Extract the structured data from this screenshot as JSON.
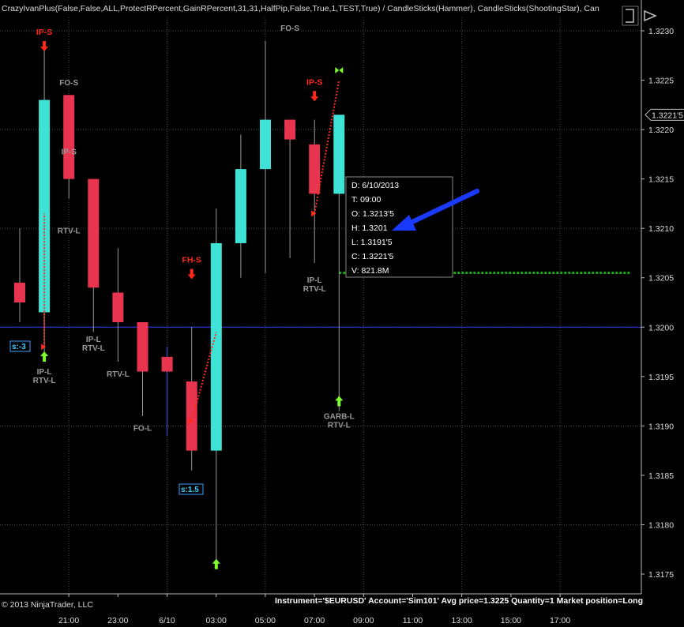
{
  "indicator_title": "CrazyIvanPlus(False,False,ALL,ProtectRPercent,GainRPercent,31,31,HalfPip,False,True,1,TEST,True) / CandleSticks(Hammer), CandleSticks(ShootingStar), Can",
  "colors": {
    "bg": "#000000",
    "up": "#3ee3d6",
    "down": "#e8344e",
    "grid": "#4a4a4a",
    "axis_text": "#dcdcdc",
    "label_gray": "#9a9a9a",
    "signal_red": "#ff2a1a",
    "signal_green": "#7cff2a",
    "blue_line": "#2a3cff",
    "green_dotted": "#1aa81a",
    "arrow_blue": "#1a3aff",
    "tooltip_border": "#8a8a8a"
  },
  "copyright": "© 2013 NinjaTrader, LLC",
  "position_info": "Instrument='$EURUSD' Account='Sim101' Avg price=1.3225 Quantity=1 Market position=Long",
  "tooltip": {
    "lines": [
      "D: 6/10/2013",
      "T: 09:00",
      "O: 1.3213'5",
      "H: 1.3201",
      "L: 1.3191'5",
      "C: 1.3221'5",
      "V: 821.8M"
    ]
  },
  "price_tag": "1.3221'5",
  "stats": [
    "s:-3",
    "s:1.5"
  ],
  "chart_data": {
    "type": "candlestick",
    "title": "",
    "y_ticks": [
      "1.3230",
      "1.3225",
      "1.3220",
      "1.3215",
      "1.3210",
      "1.3205",
      "1.3200",
      "1.3195",
      "1.3190",
      "1.3185",
      "1.3180",
      "1.3175"
    ],
    "ylim": [
      1.3172,
      1.3232
    ],
    "x_tick_labels": [
      "21:00",
      "23:00",
      "6/10",
      "03:00",
      "05:00",
      "07:00",
      "09:00",
      "11:00",
      "13:00",
      "15:00",
      "17:00"
    ],
    "x_tick_bars": [
      1,
      3,
      5,
      7,
      9,
      11,
      13,
      15,
      17,
      19,
      21
    ],
    "candles": [
      {
        "bar": 0,
        "open": 1.32045,
        "high": 1.321,
        "low": 1.32005,
        "close": 1.32025
      },
      {
        "bar": 1,
        "open": 1.32015,
        "high": 1.32285,
        "low": 1.3197,
        "close": 1.3223
      },
      {
        "bar": 2,
        "open": 1.32235,
        "high": 1.32235,
        "low": 1.3213,
        "close": 1.3215
      },
      {
        "bar": 3,
        "open": 1.3215,
        "high": 1.3215,
        "low": 1.31995,
        "close": 1.3204
      },
      {
        "bar": 4,
        "open": 1.32035,
        "high": 1.3208,
        "low": 1.31965,
        "close": 1.32005
      },
      {
        "bar": 5,
        "open": 1.32005,
        "high": 1.32005,
        "low": 1.3191,
        "close": 1.31955
      },
      {
        "bar": 6,
        "open": 1.3197,
        "high": 1.3198,
        "low": 1.3189,
        "close": 1.31955
      },
      {
        "bar": 7,
        "open": 1.31945,
        "high": 1.32,
        "low": 1.31855,
        "close": 1.31875
      },
      {
        "bar": 8,
        "open": 1.31875,
        "high": 1.3212,
        "low": 1.3176,
        "close": 1.32085
      },
      {
        "bar": 9,
        "open": 1.32085,
        "high": 1.32195,
        "low": 1.3205,
        "close": 1.3216
      },
      {
        "bar": 10,
        "open": 1.3216,
        "high": 1.3229,
        "low": 1.32055,
        "close": 1.3221
      },
      {
        "bar": 11,
        "open": 1.3221,
        "high": 1.3221,
        "low": 1.3207,
        "close": 1.3219
      },
      {
        "bar": 12,
        "open": 1.32185,
        "high": 1.3221,
        "low": 1.32065,
        "close": 1.32135
      },
      {
        "bar": 13,
        "open": 1.32135,
        "high": 1.32215,
        "low": 1.31915,
        "close": 1.32215
      }
    ],
    "horizontal_lines": [
      {
        "value": 1.32,
        "style": "solid",
        "color_key": "blue_line"
      },
      {
        "value": 1.32055,
        "style": "dotted",
        "color_key": "green_dotted",
        "from_bar": 13
      }
    ],
    "signals": [
      {
        "bar": 1,
        "type": "down-arrow",
        "color_key": "signal_red",
        "text": "IP-S",
        "at": "top"
      },
      {
        "bar": 1,
        "type": "up-arrow",
        "color_key": "signal_green",
        "text": "IP-L\nRTV-L",
        "at": 1.31965
      },
      {
        "bar": 2,
        "type": "label",
        "text": "FO-S",
        "at": 1.32245
      },
      {
        "bar": 2,
        "type": "label",
        "text": "IP-S",
        "at": 1.32175
      },
      {
        "bar": 2,
        "type": "label",
        "text": "RTV-L",
        "at": 1.32095
      },
      {
        "bar": 3,
        "type": "label",
        "text": "IP-L\nRTV-L",
        "at": 1.31985
      },
      {
        "bar": 4,
        "type": "label",
        "text": "RTV-L",
        "at": 1.3195
      },
      {
        "bar": 5,
        "type": "label",
        "text": "FO-L",
        "at": 1.31895
      },
      {
        "bar": 7,
        "type": "down-arrow",
        "color_key": "signal_red",
        "text": "FH-S",
        "at": 1.32055
      },
      {
        "bar": 8,
        "type": "up-arrow",
        "color_key": "signal_green",
        "text": "",
        "at": 1.31755
      },
      {
        "bar": 11,
        "type": "label",
        "text": "FO-S",
        "at": 1.323
      },
      {
        "bar": 12,
        "type": "down-arrow",
        "color_key": "signal_red",
        "text": "IP-S",
        "at": 1.32235
      },
      {
        "bar": 12,
        "type": "label",
        "text": "IP-L\nRTV-L",
        "at": 1.32045
      },
      {
        "bar": 13,
        "type": "up-arrow",
        "color_key": "signal_green",
        "text": "GARB-L\nRTV-L",
        "at": 1.3192
      },
      {
        "bar": 13,
        "type": "target",
        "color_key": "signal_green",
        "text": "",
        "at": 1.3226
      }
    ],
    "trade_lines": [
      {
        "from_bar": 1,
        "from": 1.3198,
        "to_bar": 1,
        "to": 1.32115
      },
      {
        "from_bar": 7,
        "from": 1.31905,
        "to_bar": 8,
        "to": 1.31995
      },
      {
        "from_bar": 12,
        "from": 1.32115,
        "to_bar": 13,
        "to": 1.3225
      }
    ]
  }
}
